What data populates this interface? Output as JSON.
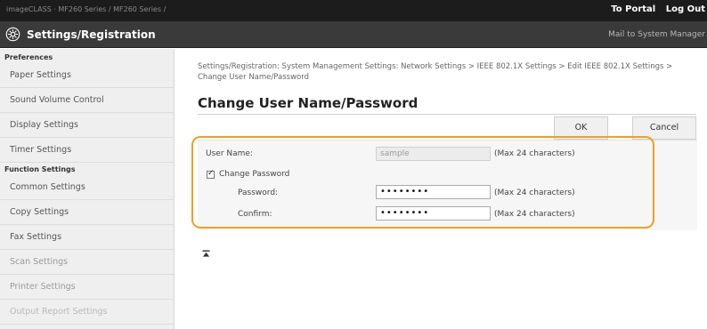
{
  "topbar": {
    "breadcrumb": "imageCLASS · MF260 Series / MF260 Series /",
    "portal_link": "To Portal",
    "logout_link": "Log Out"
  },
  "header": {
    "title": "Settings/Registration",
    "mailto": "Mail to System Manager"
  },
  "sidebar": {
    "sections": [
      {
        "title": "Preferences",
        "items": [
          "Paper Settings",
          "Sound Volume Control",
          "Display Settings",
          "Timer Settings"
        ]
      },
      {
        "title": "Function Settings",
        "items": [
          "Common Settings",
          "Copy Settings",
          "Fax Settings",
          "Scan Settings",
          "Printer Settings",
          "Output Report Settings"
        ]
      }
    ]
  },
  "main": {
    "breadcrumb": "Settings/Registration: System Management Settings: Network Settings > IEEE 802.1X Settings > Edit IEEE 802.1X Settings > Change User Name/Password",
    "title": "Change User Name/Password",
    "ok_label": "OK",
    "cancel_label": "Cancel",
    "form": {
      "user_name_label": "User Name:",
      "user_name_value": "sample",
      "user_name_note": "(Max 24 characters)",
      "change_password_label": "Change Password",
      "change_password_checked": true,
      "password_label": "Password:",
      "password_value": "••••••••",
      "password_note": "(Max 24 characters)",
      "confirm_label": "Confirm:",
      "confirm_value": "••••••••",
      "confirm_note": "(Max 24 characters)"
    },
    "to_top_icon": "to-top-icon"
  },
  "colors": {
    "topbar": "#1c1c1c",
    "headerbar": "#3a3a3a",
    "highlight": "#f0a020"
  }
}
